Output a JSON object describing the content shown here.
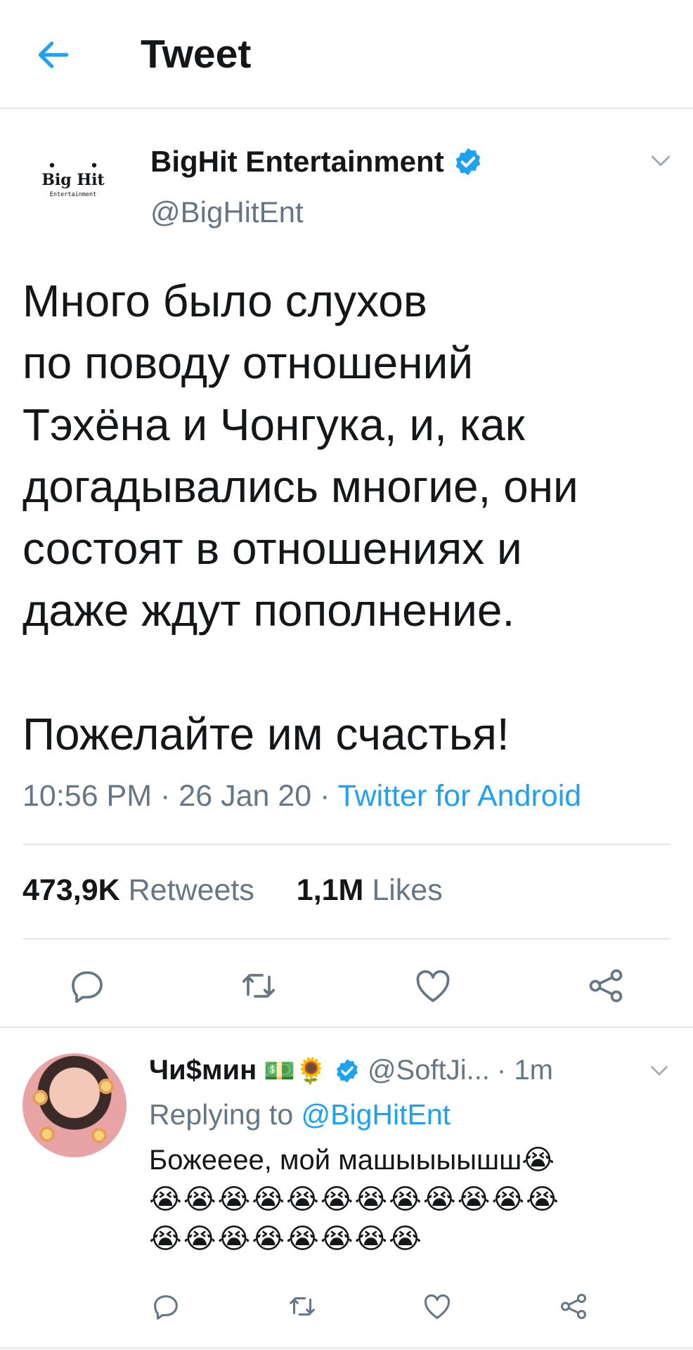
{
  "header": {
    "title": "Tweet",
    "back_icon": "arrow-left-icon"
  },
  "tweet": {
    "display_name": "BigHit Entertainment",
    "handle": "@BigHitEnt",
    "logo_main": "Big Hit",
    "logo_sub": "Entertainment",
    "text": "Много было слухов\nпо поводу отношений\nТэхёна и Чонгука, и, как\nдогадывались многие, они\nсостоят в отношениях и\nдаже ждут пополнение.\n\nПожелайте им счастья!",
    "time": "10:56 PM",
    "date": "26 Jan 20",
    "source": "Twitter for Android",
    "retweets_count": "473,9K",
    "retweets_label": "Retweets",
    "likes_count": "1,1M",
    "likes_label": "Likes"
  },
  "reply": {
    "display_name": "Чи$мин",
    "name_emoji": "💵🌻",
    "handle": "@SoftJi...",
    "age": "· 1m",
    "replying_prefix": "Replying to",
    "replying_mention": "@BigHitEnt",
    "text": "Божееее, мой машыыыышш😭",
    "emoji_line_1": "😭😭😭😭😭😭😭😭😭😭😭😭",
    "emoji_line_2": "😭😭😭😭😭😭😭😭"
  },
  "colors": {
    "accent": "#1da1f2",
    "muted": "#657786",
    "text": "#14171a",
    "divider": "#e1e8ed"
  },
  "icons": [
    "arrow-left-icon",
    "verified-badge-icon",
    "chevron-down-icon",
    "reply-icon",
    "retweet-icon",
    "like-icon",
    "share-icon"
  ]
}
